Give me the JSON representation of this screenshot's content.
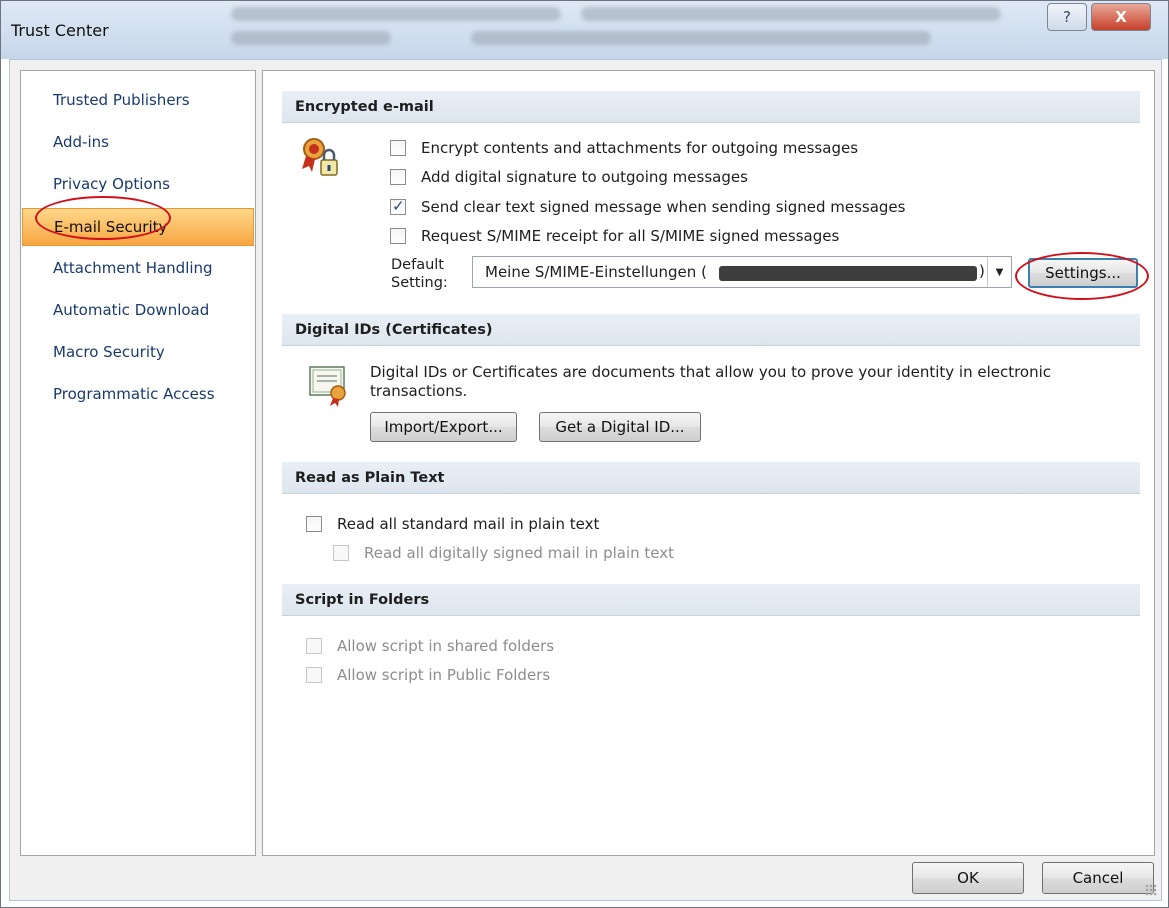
{
  "window": {
    "title": "Trust Center",
    "help_label": "?",
    "close_label": "X"
  },
  "sidebar": {
    "items": [
      {
        "label": "Trusted Publishers"
      },
      {
        "label": "Add-ins"
      },
      {
        "label": "Privacy Options"
      },
      {
        "label": "E-mail Security"
      },
      {
        "label": "Attachment Handling"
      },
      {
        "label": "Automatic Download"
      },
      {
        "label": "Macro Security"
      },
      {
        "label": "Programmatic Access"
      }
    ]
  },
  "encrypted": {
    "header": "Encrypted e-mail",
    "options": [
      {
        "label": "Encrypt contents and attachments for outgoing messages",
        "checked": false
      },
      {
        "label": "Add digital signature to outgoing messages",
        "checked": false
      },
      {
        "label": "Send clear text signed message when sending signed messages",
        "checked": true
      },
      {
        "label": "Request S/MIME receipt for all S/MIME signed messages",
        "checked": false
      }
    ],
    "default_setting_label_1": "Default",
    "default_setting_label_2": "Setting:",
    "default_setting_value": "Meine S/MIME-Einstellungen (",
    "default_setting_suffix": ")",
    "settings_button": "Settings..."
  },
  "digital_ids": {
    "header": "Digital IDs (Certificates)",
    "description": "Digital IDs or Certificates are documents that allow you to prove your identity in electronic transactions.",
    "import_export_button": "Import/Export...",
    "get_id_button": "Get a Digital ID..."
  },
  "plain_text": {
    "header": "Read as Plain Text",
    "read_all_label": "Read all standard mail in plain text",
    "read_signed_label": "Read all digitally signed mail in plain text"
  },
  "script": {
    "header": "Script in Folders",
    "shared_label": "Allow script in shared folders",
    "public_label": "Allow script in Public Folders"
  },
  "footer": {
    "ok_label": "OK",
    "cancel_label": "Cancel"
  },
  "colors": {
    "accent_active": "#f8a642",
    "highlight_circle": "#d1101b",
    "section_header": "#dde5ee"
  }
}
